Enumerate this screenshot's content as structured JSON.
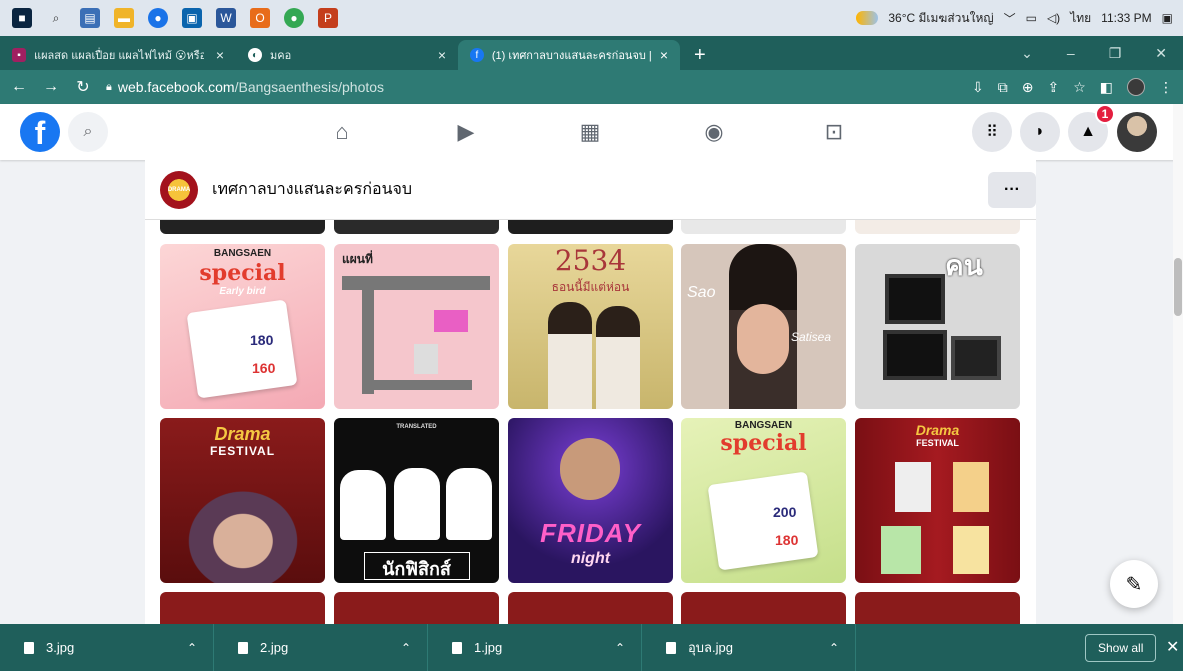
{
  "taskbar": {
    "weather": "36°C มีเมฆส่วนใหญ่",
    "language": "ไทย",
    "time": "11:33 PM",
    "icons": [
      "windows-icon",
      "search-icon",
      "task-view-icon",
      "file-explorer-icon",
      "chrome-icon",
      "store-icon",
      "word-icon",
      "office-icon",
      "chrome-icon",
      "powerpoint-icon"
    ]
  },
  "tabs": [
    {
      "title": "แผลสด แผลเปื่อย แผลไฟไหม้ 😮หรือ",
      "active": false
    },
    {
      "title": "มคอ",
      "active": false
    },
    {
      "title": "(1) เทศกาลบางแสนละครก่อนจบ | Fac",
      "active": true
    }
  ],
  "address": {
    "domain": "web.facebook.com",
    "path": "/Bangsaenthesis/photos"
  },
  "facebook": {
    "notification_count": "1",
    "page_name": "เทศกาลบางแสนละครก่อนจบ",
    "more_label": "···"
  },
  "tiles": {
    "t1_brand": "BANGSAEN",
    "t1_title": "special",
    "t1_sub": "Early bird",
    "t1_price1": "180",
    "t1_price2": "160",
    "t2_title": "แผนที่",
    "t3_title": "2534",
    "t3_sub": "ธอนนี้มีแต่ห่อน",
    "t4_name1": "Sao",
    "t4_name2": "Satisea",
    "t5_title": "คน",
    "t6_title": "Drama",
    "t6_sub": "FESTIVAL",
    "t7_top": "TRANSLATED",
    "t7_caption": "นักฟิสิกส์",
    "t8_title": "FRIDAY",
    "t8_sub": "night",
    "t9_brand": "BANGSAEN",
    "t9_title": "special",
    "t9_price1": "200",
    "t9_price2": "180",
    "t10_title": "Drama",
    "t10_sub": "FESTIVAL"
  },
  "downloads": [
    {
      "name": "3.jpg"
    },
    {
      "name": "2.jpg"
    },
    {
      "name": "1.jpg"
    },
    {
      "name": "อุบล.jpg"
    }
  ],
  "shelf": {
    "show_all": "Show all"
  }
}
